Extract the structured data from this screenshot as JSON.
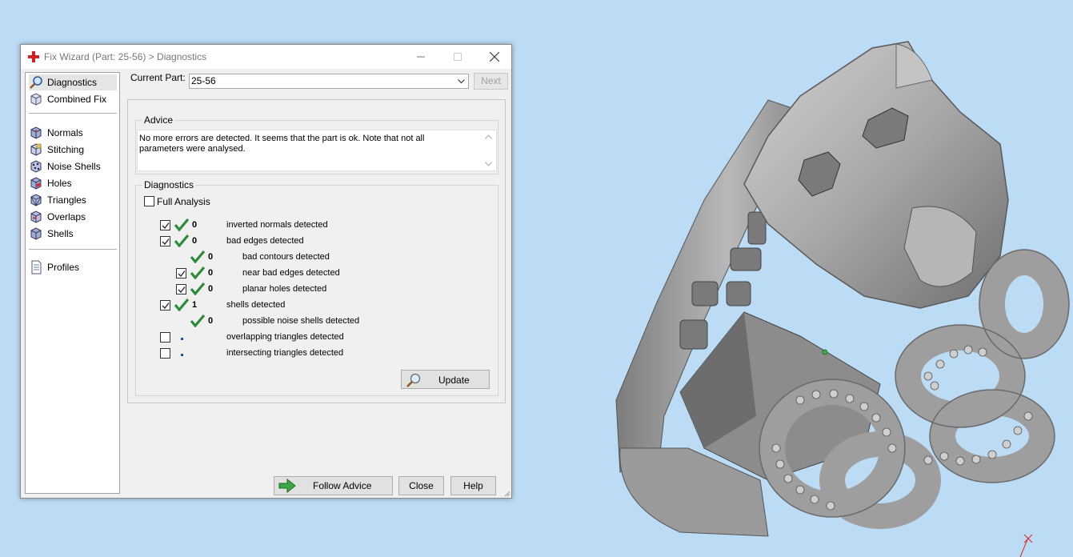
{
  "window": {
    "title": "Fix Wizard (Part: 25-56) > Diagnostics",
    "icon": "red-cross-icon"
  },
  "nav": {
    "items": [
      {
        "label": "Diagnostics",
        "icon": "magnifier-icon",
        "selected": true
      },
      {
        "label": "Combined Fix",
        "icon": "cube-icon"
      },
      {
        "label": "Normals",
        "icon": "normals-cube-icon"
      },
      {
        "label": "Stitching",
        "icon": "stitching-cube-icon"
      },
      {
        "label": "Noise Shells",
        "icon": "noise-shells-icon"
      },
      {
        "label": "Holes",
        "icon": "holes-cube-icon"
      },
      {
        "label": "Triangles",
        "icon": "triangles-cube-icon"
      },
      {
        "label": "Overlaps",
        "icon": "overlaps-cube-icon"
      },
      {
        "label": "Shells",
        "icon": "shells-cube-icon"
      },
      {
        "label": "Profiles",
        "icon": "document-icon"
      }
    ]
  },
  "header": {
    "current_part_label": "Current Part:",
    "current_part_value": "25-56",
    "next_label": "Next"
  },
  "advice": {
    "title": "Advice",
    "text": "No more errors are detected. It seems that the part is ok. Note that not all parameters were analysed."
  },
  "diagnostics": {
    "title": "Diagnostics",
    "full_analysis_label": "Full Analysis",
    "full_analysis_checked": false,
    "rows": [
      {
        "checked": true,
        "status": "ok",
        "count": "0",
        "label": "inverted normals detected",
        "level": 0
      },
      {
        "checked": true,
        "status": "ok",
        "count": "0",
        "label": "bad edges detected",
        "level": 0
      },
      {
        "checked": null,
        "status": "ok",
        "count": "0",
        "label": "bad contours detected",
        "level": 1
      },
      {
        "checked": true,
        "status": "ok",
        "count": "0",
        "label": "near bad edges detected",
        "level": 1
      },
      {
        "checked": true,
        "status": "ok",
        "count": "0",
        "label": "planar holes detected",
        "level": 1
      },
      {
        "checked": true,
        "status": "ok",
        "count": "1",
        "label": "shells detected",
        "level": 0
      },
      {
        "checked": null,
        "status": "ok",
        "count": "0",
        "label": "possible noise shells detected",
        "level": 1
      },
      {
        "checked": false,
        "status": "pending",
        "count": "",
        "label": "overlapping triangles detected",
        "level": 0
      },
      {
        "checked": false,
        "status": "pending",
        "count": "",
        "label": "intersecting triangles detected",
        "level": 0
      }
    ],
    "update_label": "Update"
  },
  "footer": {
    "follow_label": "Follow Advice",
    "close_label": "Close",
    "help_label": "Help"
  },
  "colors": {
    "viewport_bg": "#bcdcf5",
    "model_gray": "#a9a9a9",
    "check_green": "#2e8b3a"
  }
}
